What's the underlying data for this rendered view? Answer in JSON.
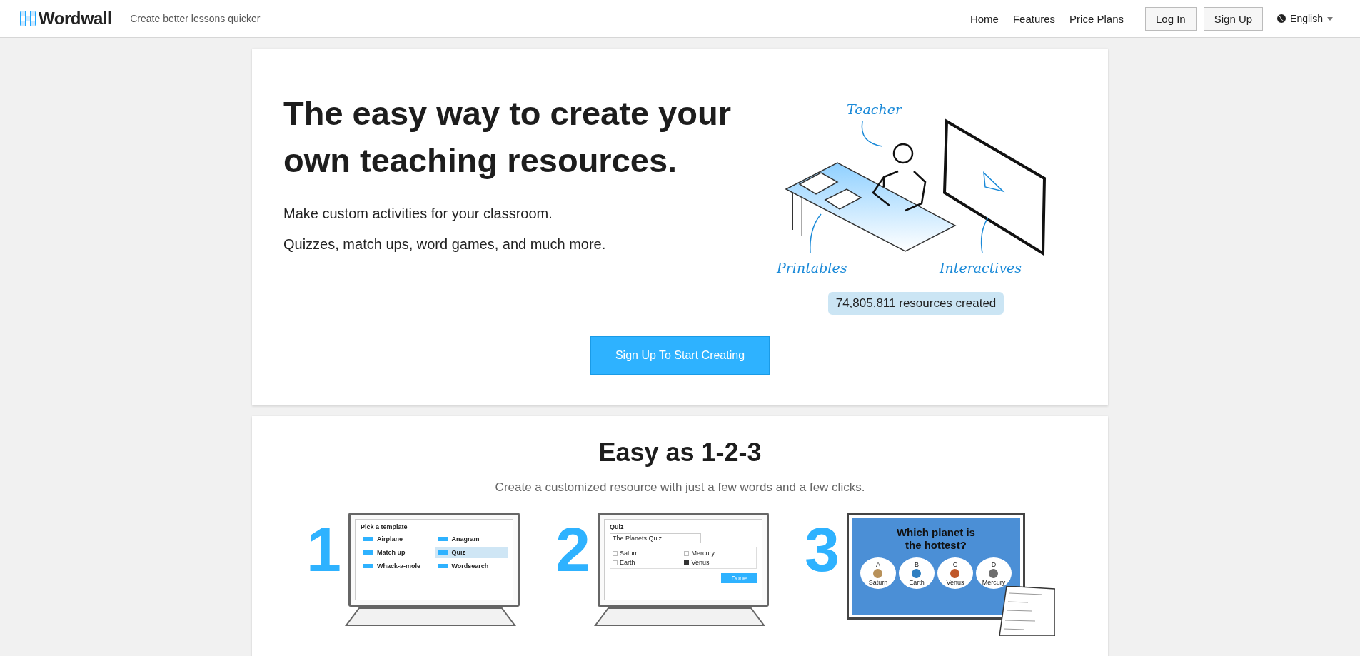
{
  "header": {
    "logo": "Wordwall",
    "tagline": "Create better lessons quicker",
    "nav": [
      {
        "label": "Home"
      },
      {
        "label": "Features"
      },
      {
        "label": "Price Plans"
      }
    ],
    "buttons": [
      {
        "label": "Log In"
      },
      {
        "label": "Sign Up"
      }
    ],
    "language": "English"
  },
  "hero": {
    "title": "The easy way to create your own teaching resources.",
    "lines": [
      "Make custom activities for your classroom.",
      "Quizzes, match ups, word games, and much more."
    ],
    "illustration_labels": {
      "teacher": "Teacher",
      "printables": "Printables",
      "interactives": "Interactives"
    },
    "count": "74,805,811 resources created",
    "cta": "Sign Up To Start Creating"
  },
  "steps_section": {
    "title": "Easy as 1-2-3",
    "subtitle": "Create a customized resource with just a few words and a few clicks.",
    "steps": [
      {
        "number": "1",
        "kind": "templates",
        "screen_title": "Pick a template",
        "templates": [
          {
            "name": "Airplane",
            "selected": false
          },
          {
            "name": "Anagram",
            "selected": false
          },
          {
            "name": "Match up",
            "selected": false
          },
          {
            "name": "Quiz",
            "selected": true
          },
          {
            "name": "Whack-a-mole",
            "selected": false
          },
          {
            "name": "Wordsearch",
            "selected": false
          }
        ]
      },
      {
        "number": "2",
        "kind": "editor",
        "screen_title": "Quiz",
        "quiz_name": "The Planets Quiz",
        "answers": [
          {
            "name": "Saturn",
            "checked": false
          },
          {
            "name": "Mercury",
            "checked": false
          },
          {
            "name": "Earth",
            "checked": false
          },
          {
            "name": "Venus",
            "checked": true
          }
        ],
        "button": "Done"
      },
      {
        "number": "3",
        "kind": "game",
        "question": "Which planet is the hottest?",
        "options": [
          {
            "letter": "A",
            "name": "Saturn",
            "color": "#b8915a"
          },
          {
            "letter": "B",
            "name": "Earth",
            "color": "#2f7fc1"
          },
          {
            "letter": "C",
            "name": "Venus",
            "color": "#c0582a"
          },
          {
            "letter": "D",
            "name": "Mercury",
            "color": "#6e6e6e"
          }
        ]
      }
    ]
  }
}
